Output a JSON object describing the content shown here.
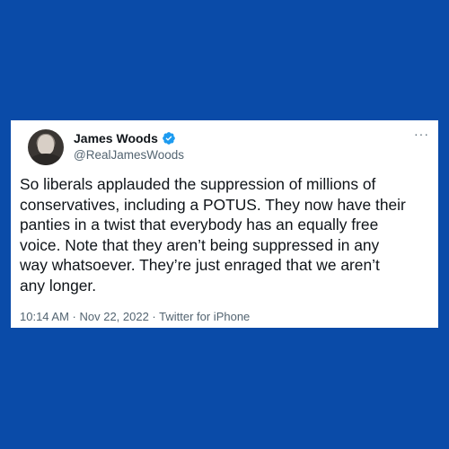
{
  "tweet": {
    "author_name": "James Woods",
    "author_handle": "@RealJamesWoods",
    "verified_icon": "verified-badge-icon",
    "more_label": "···",
    "text": "So liberals applauded the suppression of millions of\nconservatives, including a POTUS. They now have their\npanties in a twist that everybody has an equally free\nvoice. Note that they aren’t being suppressed in any\nway whatsoever. They’re just enraged that we aren’t\nany longer.",
    "meta": "10:14 AM · Nov 22, 2022 · Twitter for iPhone"
  },
  "colors": {
    "background": "#0a4ba8",
    "card": "#ffffff",
    "verified_blue": "#1d9bf0",
    "text_primary": "#0f1419",
    "text_secondary": "#536471"
  }
}
